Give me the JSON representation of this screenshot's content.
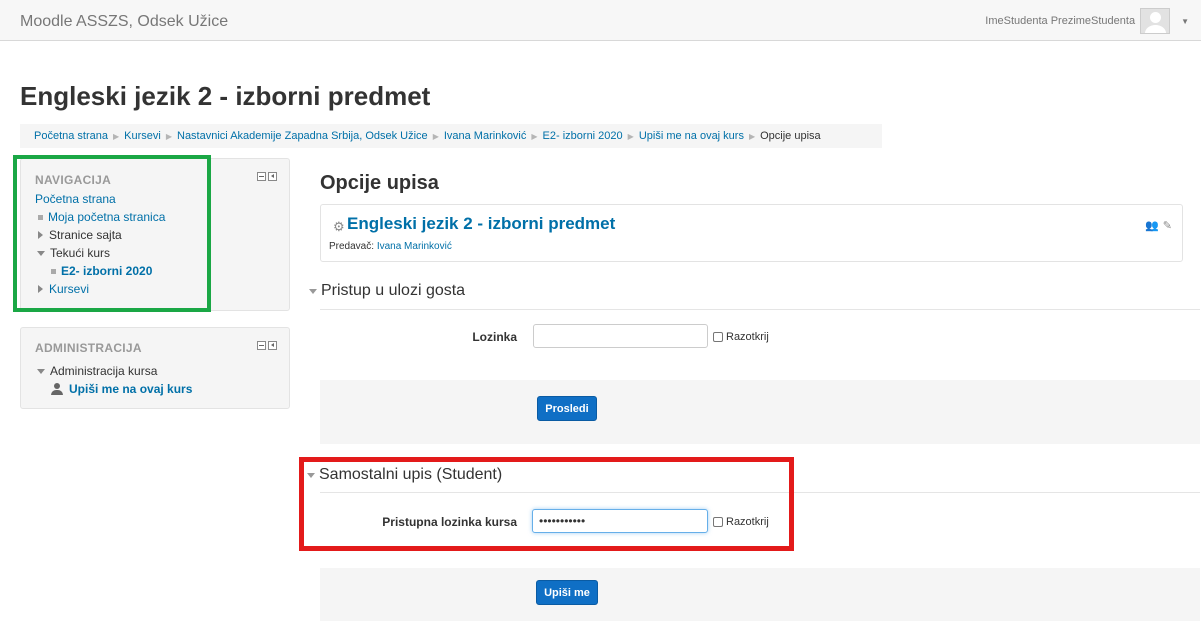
{
  "header": {
    "site_name": "Moodle ASSZS, Odsek Užice",
    "user_name": "ImeStudenta PrezimeStudenta"
  },
  "page_title": "Engleski jezik 2 - izborni predmet",
  "breadcrumb": [
    "Početna strana",
    "Kursevi",
    "Nastavnici Akademije Zapadna Srbija, Odsek Užice",
    "Ivana Marinković",
    "E2- izborni 2020",
    "Upiši me na ovaj kurs",
    "Opcije upisa"
  ],
  "navigation": {
    "title": "NAVIGACIJA",
    "items": [
      "Početna strana",
      "Moja početna stranica",
      "Stranice sajta",
      "Tekući kurs",
      "E2- izborni 2020",
      "Kursevi"
    ]
  },
  "administration": {
    "title": "ADMINISTRACIJA",
    "items": [
      "Administracija kursa",
      "Upiši me na ovaj kurs"
    ]
  },
  "main": {
    "heading": "Opcije upisa",
    "course": {
      "name": "Engleski jezik 2 - izborni predmet",
      "teacher_label": "Predavač:",
      "teacher_name": "Ivana Marinković"
    },
    "guest_access": {
      "title": "Pristup u ulozi gosta",
      "password_label": "Lozinka",
      "password_value": "",
      "reveal_label": "Razotkrij",
      "submit_label": "Prosledi"
    },
    "self_enrol": {
      "title": "Samostalni upis (Student)",
      "password_label": "Pristupna lozinka kursa",
      "password_value": "•••••••••••",
      "reveal_label": "Razotkrij",
      "submit_label": "Upiši me"
    }
  },
  "colors": {
    "link": "#0070a8",
    "button": "#0f6fc5",
    "nav_highlight": "#1aa745",
    "enrol_highlight": "#e31a1a"
  }
}
